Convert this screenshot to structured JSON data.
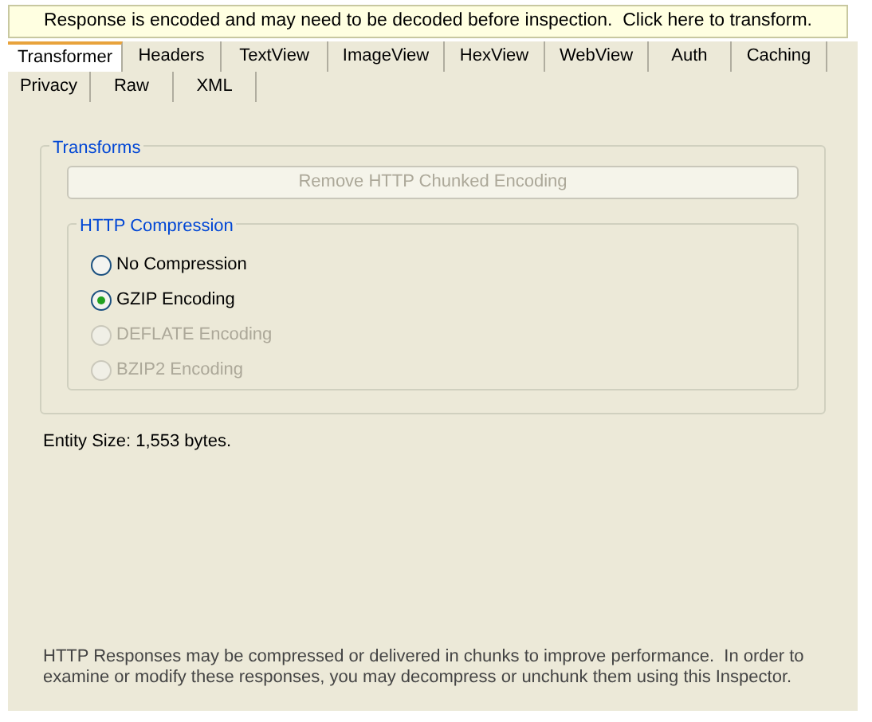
{
  "banner": "Response is encoded and may need to be decoded before inspection.  Click here to transform.",
  "tab_rows": [
    [
      {
        "label": "Transformer",
        "selected": true
      },
      {
        "label": "Headers",
        "selected": false
      },
      {
        "label": "TextView",
        "selected": false
      },
      {
        "label": "ImageView",
        "selected": false
      },
      {
        "label": "HexView",
        "selected": false
      },
      {
        "label": "WebView",
        "selected": false
      },
      {
        "label": "Auth",
        "selected": false
      },
      {
        "label": "Caching",
        "selected": false
      }
    ],
    [
      {
        "label": "Privacy",
        "selected": false
      },
      {
        "label": "Raw",
        "selected": false
      },
      {
        "label": "XML",
        "selected": false
      }
    ]
  ],
  "transforms": {
    "title": "Transforms",
    "button": {
      "label": "Remove HTTP Chunked Encoding",
      "disabled": true
    },
    "compression": {
      "title": "HTTP Compression",
      "options": [
        {
          "label": "No Compression",
          "selected": false,
          "disabled": false
        },
        {
          "label": "GZIP Encoding",
          "selected": true,
          "disabled": false
        },
        {
          "label": "DEFLATE Encoding",
          "selected": false,
          "disabled": true
        },
        {
          "label": "BZIP2 Encoding",
          "selected": false,
          "disabled": true
        }
      ]
    }
  },
  "entity_size": "Entity Size: 1,553 bytes.",
  "footer": "HTTP Responses may be compressed or delivered in chunks to improve performance.  In order to examine or modify these responses, you may decompress or unchunk them using this Inspector."
}
